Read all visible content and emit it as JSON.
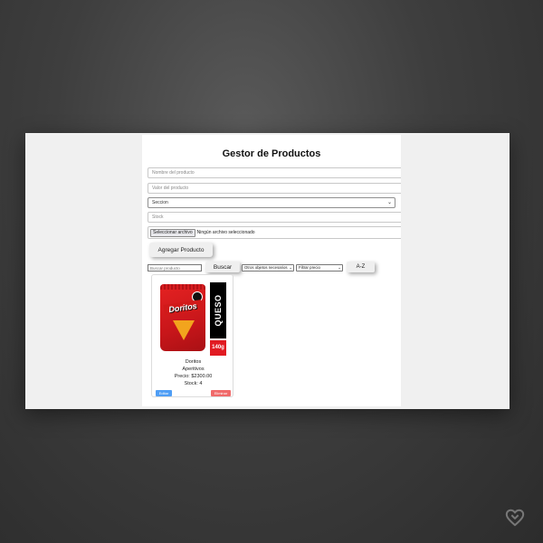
{
  "app": {
    "title": "Gestor de Productos"
  },
  "form": {
    "name_placeholder": "Nombre del producto",
    "value_placeholder": "Valor del producto",
    "section_selected": "Seccion",
    "stock_placeholder": "Stock",
    "file_button_label": "Seleccionar archivo",
    "file_status": "Ningún archivo seleccionado",
    "add_button_label": "Agregar Producto"
  },
  "toolbar": {
    "search_placeholder": "Buscar producto",
    "search_button_label": "Buscar",
    "category_filter_selected": "Otros objetos necesarios",
    "price_filter_selected": "Filtrar precio",
    "sort_button_label": "A-Z"
  },
  "products": [
    {
      "image_label_text": "QUESO",
      "image_weight_text": "140g",
      "image_brand_text": "Doritos",
      "name": "Doritos",
      "section": "Aperitivos",
      "price_text": "Precio: $2300.00",
      "stock_text": "Stock: 4",
      "edit_label": "Editar",
      "delete_label": "Eliminar"
    }
  ],
  "colors": {
    "edit_button": "#4f9ef5",
    "delete_button": "#f06a6a",
    "page_background": "#f0f0f0"
  },
  "icons": {
    "select_chevron": "chevron-down-icon",
    "watermark": "heart-icon"
  }
}
